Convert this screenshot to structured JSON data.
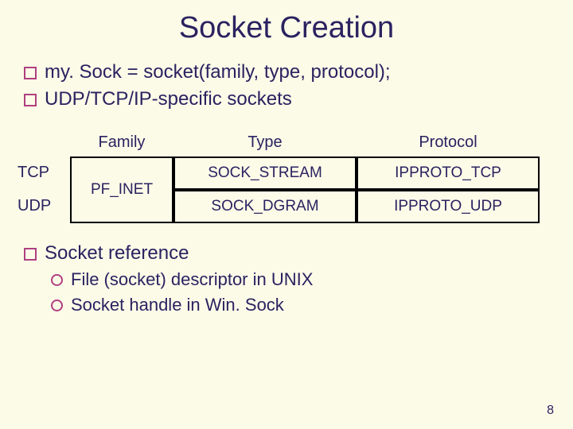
{
  "title": "Socket Creation",
  "bullets_top": [
    "my. Sock = socket(family, type, protocol);",
    "UDP/TCP/IP-specific sockets"
  ],
  "table": {
    "headers": {
      "family": "Family",
      "type": "Type",
      "protocol": "Protocol"
    },
    "row_labels": [
      "TCP",
      "UDP"
    ],
    "family_cell": "PF_INET",
    "type_cells": [
      "SOCK_STREAM",
      "SOCK_DGRAM"
    ],
    "proto_cells": [
      "IPPROTO_TCP",
      "IPPROTO_UDP"
    ]
  },
  "bullet_bottom": "Socket reference",
  "sub_bullets": [
    "File (socket) descriptor in UNIX",
    "Socket handle in Win. Sock"
  ],
  "page_number": "8"
}
